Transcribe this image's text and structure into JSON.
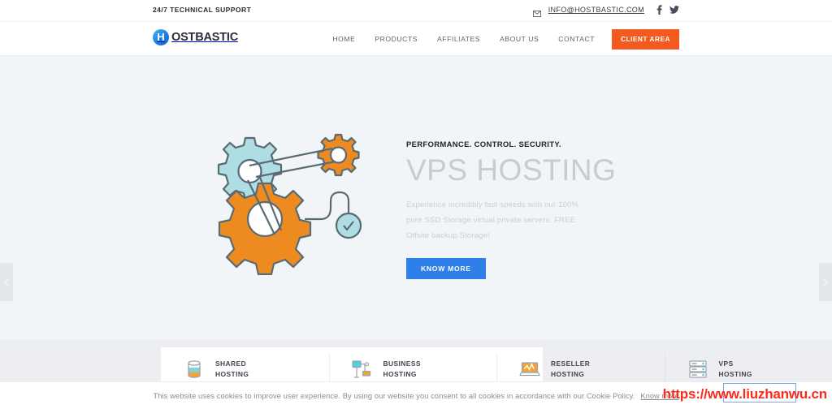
{
  "topbar": {
    "tagline": "24/7 TECHNICAL SUPPORT",
    "email": "INFO@HOSTBASTIC.COM",
    "mail_icon": "envelope-icon",
    "social": [
      {
        "name": "facebook-icon",
        "label": "f"
      },
      {
        "name": "twitter-icon",
        "label": "t"
      }
    ]
  },
  "header": {
    "logo_mark": "H",
    "logo_text": "OSTBASTIC",
    "nav": [
      {
        "label": "HOME",
        "name": "nav-home"
      },
      {
        "label": "PRODUCTS",
        "name": "nav-products"
      },
      {
        "label": "AFFILIATES",
        "name": "nav-affiliates"
      },
      {
        "label": "ABOUT US",
        "name": "nav-about-us"
      },
      {
        "label": "CONTACT",
        "name": "nav-contact"
      }
    ],
    "client_area_label": "CLIENT AREA"
  },
  "hero": {
    "eyebrow": "PERFORMANCE. CONTROL. SECURITY.",
    "title": "VPS HOSTING",
    "description": "Experience incredibly fast speeds with our 100% pure SSD Storage virtual private servers. FREE Offsite backup Storage!",
    "button_label": "KNOW MORE",
    "prev_arrow": "chevron-left-icon",
    "next_arrow": "chevron-right-icon",
    "illustration": "gears-illustration"
  },
  "services": [
    {
      "icon": "database-icon",
      "line1": "SHARED",
      "line2": "HOSTING"
    },
    {
      "icon": "network-monitor-icon",
      "line1": "BUSINESS",
      "line2": "HOSTING"
    },
    {
      "icon": "laptop-chart-icon",
      "line1": "RESELLER",
      "line2": "HOSTING"
    },
    {
      "icon": "server-rack-icon",
      "line1": "VPS",
      "line2": "HOSTING"
    }
  ],
  "cookie": {
    "message": "This website uses cookies to improve user experience. By using our website you consent to all cookies in accordance with our Cookie Policy.",
    "link_label": "Know more"
  },
  "watermark": {
    "url": "https://www.liuzhanwu.cn"
  },
  "colors": {
    "accent_orange": "#f4591f",
    "accent_blue": "#2e7fe8",
    "hero_bg": "#f2f5f8",
    "band_bg": "#edeef2",
    "title_gray": "#c6ccd4",
    "watermark_red": "#fb2a1a"
  }
}
